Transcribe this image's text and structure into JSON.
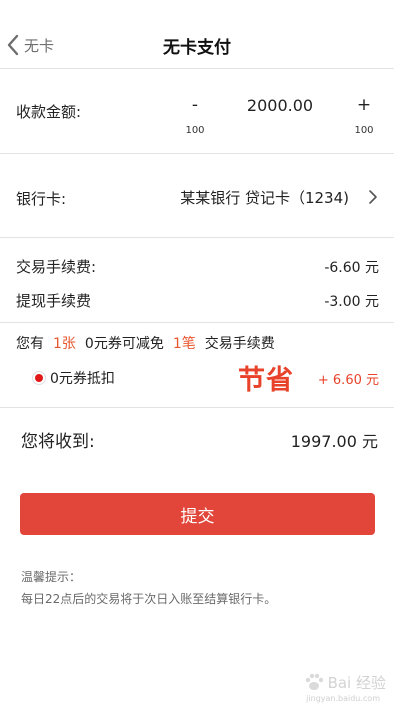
{
  "nav": {
    "back_label": "无卡",
    "title": "无卡支付"
  },
  "amount": {
    "label": "收款金额:",
    "minus_label": "-",
    "plus_label": "+",
    "value": "2000.00",
    "minus_step": "100",
    "plus_step": "100"
  },
  "bank": {
    "label": "银行卡:",
    "value": "某某银行 贷记卡（1234)"
  },
  "fees": {
    "transaction_label": "交易手续费:",
    "transaction_value": "-6.60 元",
    "withdraw_label": "提现手续费",
    "withdraw_value": "-3.00 元"
  },
  "coupon": {
    "prefix": "您有",
    "count": "1张",
    "middle": "0元券可减免",
    "times": "1笔",
    "suffix": "交易手续费",
    "option_label": "0元券抵扣",
    "annotation": "节省",
    "saving": "+ 6.60 元",
    "selected": true
  },
  "receive": {
    "label": "您将收到:",
    "value": "1997.00 元"
  },
  "submit_label": "提交",
  "tips": {
    "title": "温馨提示：",
    "text": "每日22点后的交易将于次日入账至结算银行卡。"
  },
  "watermark": {
    "text": "Bai 经验",
    "sub": "jingyan.baidu.com"
  },
  "colors": {
    "accent": "#e2463a",
    "highlight": "#e8572f",
    "divider": "#e3e3e3"
  }
}
